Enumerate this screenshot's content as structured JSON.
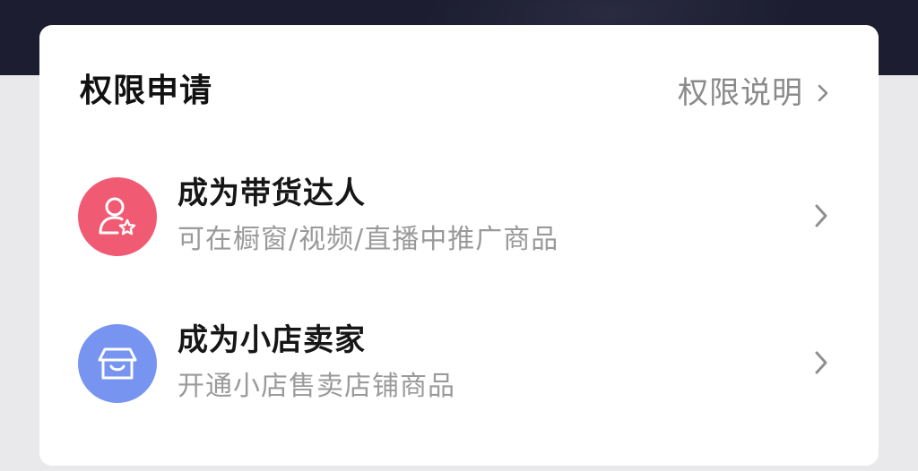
{
  "header": {
    "title": "权限申请",
    "link_label": "权限说明"
  },
  "items": [
    {
      "title": "成为带货达人",
      "subtitle": "可在橱窗/视频/直播中推广商品",
      "icon": "user-star-icon",
      "icon_color": "#f05b73"
    },
    {
      "title": "成为小店卖家",
      "subtitle": "开通小店售卖店铺商品",
      "icon": "shop-icon",
      "icon_color": "#7794f0"
    }
  ],
  "colors": {
    "top_band": "#1c1d30",
    "page_background": "#e9e9eb",
    "card_background": "#ffffff"
  }
}
